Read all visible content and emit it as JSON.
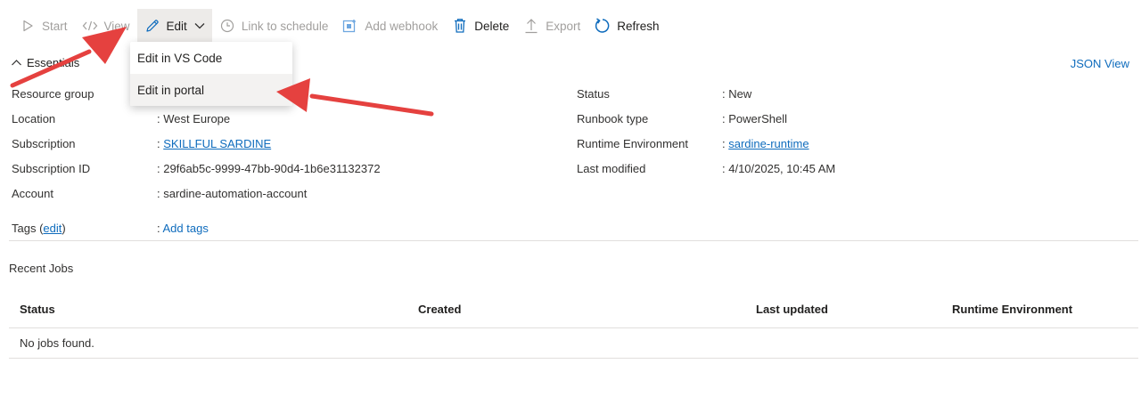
{
  "toolbar": {
    "start": "Start",
    "view": "View",
    "edit": "Edit",
    "link_schedule": "Link to schedule",
    "add_webhook": "Add webhook",
    "delete": "Delete",
    "export": "Export",
    "refresh": "Refresh"
  },
  "dropdown": {
    "items": [
      "Edit in VS Code",
      "Edit in portal"
    ]
  },
  "essentials": {
    "title": "Essentials",
    "json_view": "JSON View",
    "left": [
      {
        "label": "Resource group",
        "value": ""
      },
      {
        "label": "Location",
        "value": ": West Europe"
      },
      {
        "label": "Subscription",
        "value": "SKILLFUL SARDINE"
      },
      {
        "label": "Subscription ID",
        "value": ": 29f6ab5c-9999-47bb-90d4-1b6e31132372"
      },
      {
        "label": "Account",
        "value": ": sardine-automation-account"
      }
    ],
    "right": [
      {
        "label": "Status",
        "value": ": New"
      },
      {
        "label": "Runbook type",
        "value": ": PowerShell"
      },
      {
        "label": "Runtime Environment",
        "value": "sardine-runtime"
      },
      {
        "label": "Last modified",
        "value": ": 4/10/2025, 10:45 AM"
      }
    ],
    "tags_label_prefix": "Tags (",
    "tags_edit": "edit",
    "tags_label_suffix": ")",
    "add_tags": "Add tags"
  },
  "recent_jobs": {
    "title": "Recent Jobs",
    "columns": [
      "Status",
      "Created",
      "Last updated",
      "Runtime Environment"
    ],
    "empty": "No jobs found."
  },
  "colors": {
    "link": "#0f6cbd",
    "arrow": "#e5413f"
  }
}
